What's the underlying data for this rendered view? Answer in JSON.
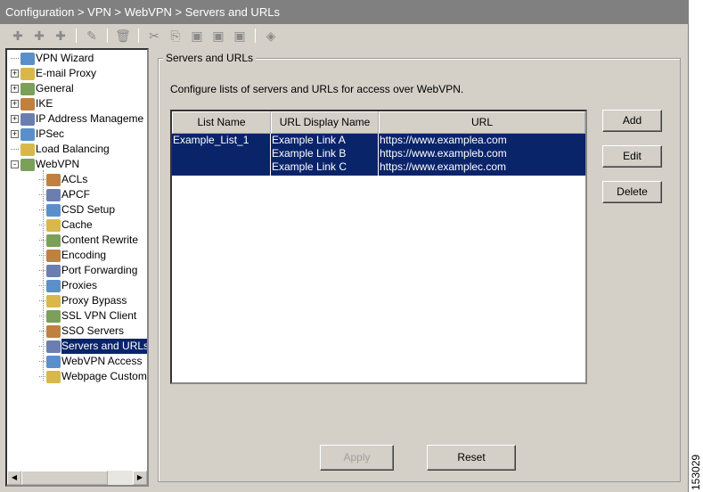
{
  "title": "Configuration > VPN > WebVPN > Servers and URLs",
  "toolbar": [
    "add",
    "insert",
    "insert-after",
    "edit",
    "delete",
    "cut",
    "copy",
    "paste",
    "paste-after",
    "paste-before",
    "find"
  ],
  "tree": [
    {
      "label": "VPN Wizard",
      "level": 0,
      "expander": ""
    },
    {
      "label": "E-mail Proxy",
      "level": 0,
      "expander": "+"
    },
    {
      "label": "General",
      "level": 0,
      "expander": "+"
    },
    {
      "label": "IKE",
      "level": 0,
      "expander": "+"
    },
    {
      "label": "IP Address Manageme",
      "level": 0,
      "expander": "+"
    },
    {
      "label": "IPSec",
      "level": 0,
      "expander": "+"
    },
    {
      "label": "Load Balancing",
      "level": 0,
      "expander": ""
    },
    {
      "label": "WebVPN",
      "level": 0,
      "expander": "-"
    },
    {
      "label": "ACLs",
      "level": 1
    },
    {
      "label": "APCF",
      "level": 1
    },
    {
      "label": "CSD Setup",
      "level": 1
    },
    {
      "label": "Cache",
      "level": 1
    },
    {
      "label": "Content Rewrite",
      "level": 1
    },
    {
      "label": "Encoding",
      "level": 1
    },
    {
      "label": "Port Forwarding",
      "level": 1
    },
    {
      "label": "Proxies",
      "level": 1
    },
    {
      "label": "Proxy Bypass",
      "level": 1
    },
    {
      "label": "SSL VPN Client",
      "level": 1
    },
    {
      "label": "SSO Servers",
      "level": 1
    },
    {
      "label": "Servers and URLs",
      "level": 1,
      "selected": true
    },
    {
      "label": "WebVPN Access",
      "level": 1
    },
    {
      "label": "Webpage Customiz",
      "level": 1
    }
  ],
  "main": {
    "group_label": "Servers and URLs",
    "description": "Configure lists of servers and URLs for access over WebVPN.",
    "columns": [
      "List Name",
      "URL Display Name",
      "URL"
    ],
    "row": {
      "list_name": "Example_List_1",
      "display_names": [
        "Example Link A",
        "Example Link B",
        "Example Link C"
      ],
      "urls": [
        "https://www.examplea.com",
        "https://www.exampleb.com",
        "https://www.examplec.com"
      ]
    },
    "buttons": {
      "add": "Add",
      "edit": "Edit",
      "delete": "Delete",
      "apply": "Apply",
      "reset": "Reset"
    }
  },
  "figure_code": "153029"
}
